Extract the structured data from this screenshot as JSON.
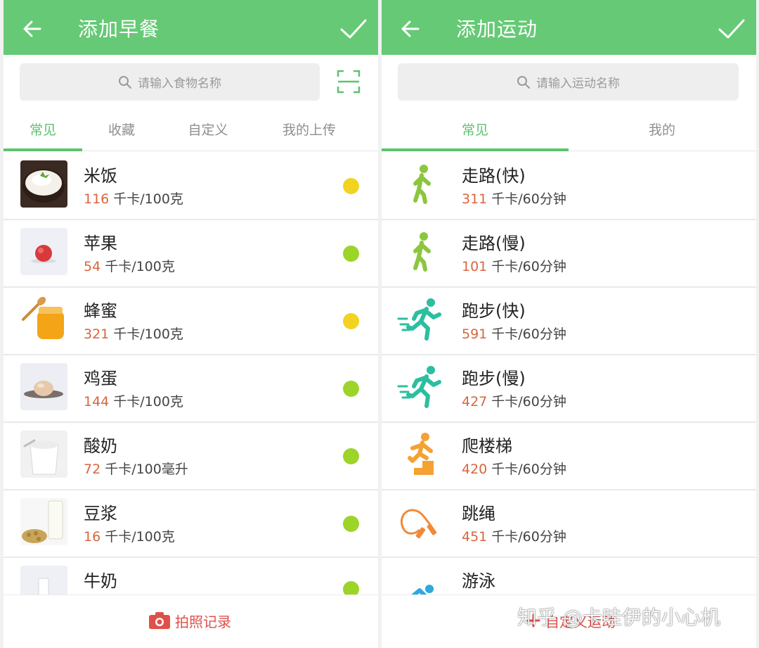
{
  "food": {
    "title": "添加早餐",
    "search_placeholder": "请输入食物名称",
    "tabs": [
      "常见",
      "收藏",
      "自定义",
      "我的上传"
    ],
    "items": [
      {
        "name": "米饭",
        "cal": "116",
        "unit": "千卡/100克",
        "dot_color": "#f2d321"
      },
      {
        "name": "苹果",
        "cal": "54",
        "unit": "千卡/100克",
        "dot_color": "#9cd42a"
      },
      {
        "name": "蜂蜜",
        "cal": "321",
        "unit": "千卡/100克",
        "dot_color": "#f2d321"
      },
      {
        "name": "鸡蛋",
        "cal": "144",
        "unit": "千卡/100克",
        "dot_color": "#9cd42a"
      },
      {
        "name": "酸奶",
        "cal": "72",
        "unit": "千卡/100毫升",
        "dot_color": "#9cd42a"
      },
      {
        "name": "豆浆",
        "cal": "16",
        "unit": "千卡/100克",
        "dot_color": "#9cd42a"
      },
      {
        "name": "牛奶",
        "cal": "",
        "unit": "",
        "dot_color": "#9cd42a"
      }
    ],
    "bottom_button": "拍照记录"
  },
  "exercise": {
    "title": "添加运动",
    "search_placeholder": "请输入运动名称",
    "tabs": [
      "常见",
      "我的"
    ],
    "items": [
      {
        "name": "走路(快)",
        "cal": "311",
        "unit": "千卡/60分钟",
        "icon": "walking-icon"
      },
      {
        "name": "走路(慢)",
        "cal": "101",
        "unit": "千卡/60分钟",
        "icon": "walking-icon"
      },
      {
        "name": "跑步(快)",
        "cal": "591",
        "unit": "千卡/60分钟",
        "icon": "running-icon"
      },
      {
        "name": "跑步(慢)",
        "cal": "427",
        "unit": "千卡/60分钟",
        "icon": "running-icon"
      },
      {
        "name": "爬楼梯",
        "cal": "420",
        "unit": "千卡/60分钟",
        "icon": "stairs-icon"
      },
      {
        "name": "跳绳",
        "cal": "451",
        "unit": "千卡/60分钟",
        "icon": "jump-rope-icon"
      },
      {
        "name": "游泳",
        "cal": "",
        "unit": "",
        "icon": "swimming-icon"
      }
    ],
    "bottom_button": "自定义运动"
  },
  "watermark": "知乎 @卡哇伊的小心机",
  "colors": {
    "header": "#66c976",
    "accent": "#5ec26e",
    "calorie": "#d9653f",
    "action": "#e0504a"
  }
}
